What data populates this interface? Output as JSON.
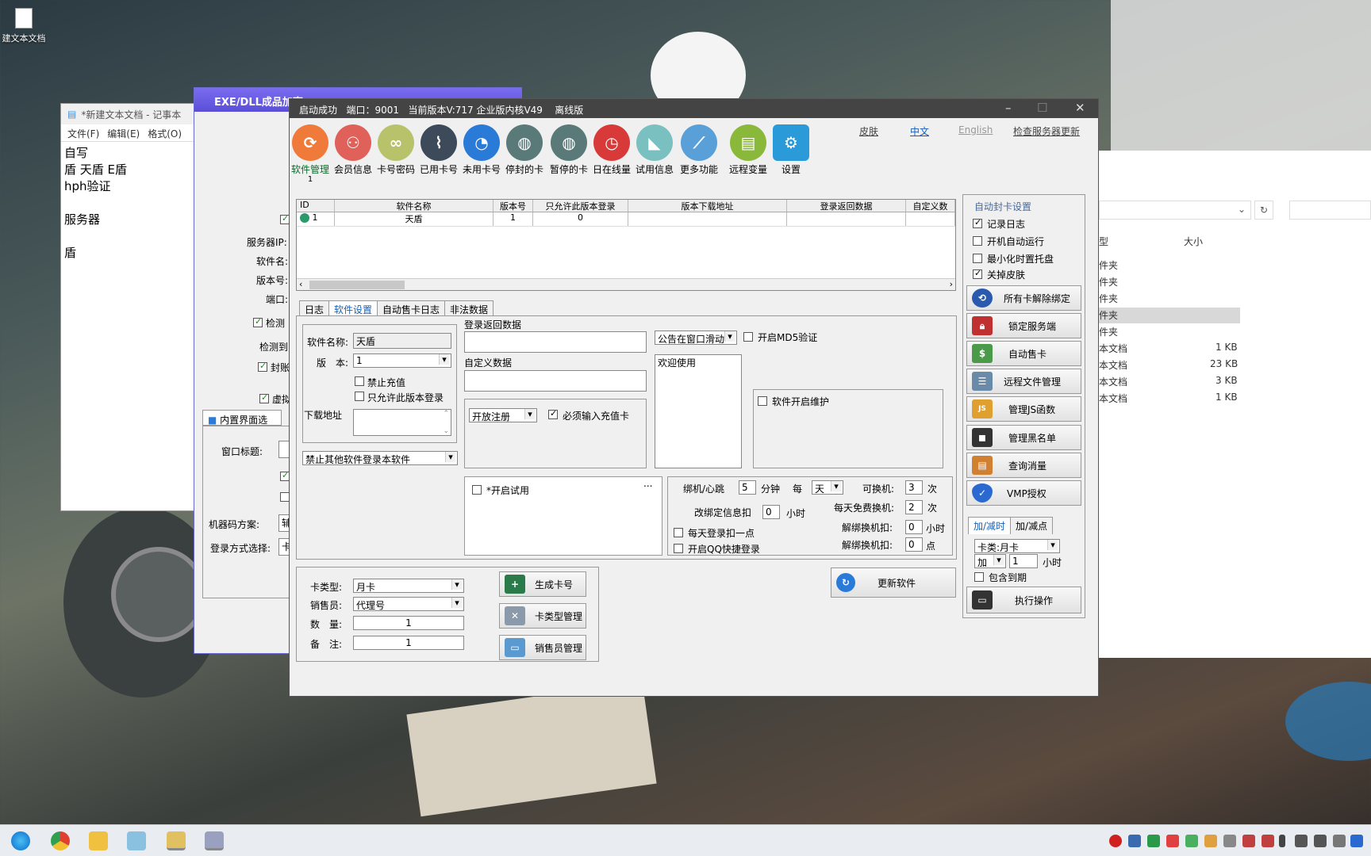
{
  "desktop": {
    "icon_label": "建文本文档"
  },
  "notepad": {
    "title": "*新建文本文档 - 记事本",
    "menu": [
      "文件(F)",
      "编辑(E)",
      "格式(O)"
    ],
    "content": "自写\n盾 天盾 E盾\nhph验证\n\n服务器\n\n盾"
  },
  "exewin": {
    "title": "EXE/DLL成品加壳",
    "labels": {
      "server_ip": "服务器IP:",
      "soft_name": "软件名:",
      "version": "版本号:",
      "port": "端口:",
      "detect": "检测",
      "detect2": "检测到",
      "block": "封账",
      "virtual": "虚拟",
      "tab": "内置界面选择",
      "win_title": "窗口标题:",
      "machine": "机器码方案:",
      "login": "登录方式选择:"
    }
  },
  "explorer": {
    "headers": {
      "type": "型",
      "size": "大小"
    },
    "rows": [
      {
        "t": "件夹",
        "s": ""
      },
      {
        "t": "件夹",
        "s": ""
      },
      {
        "t": "件夹",
        "s": ""
      },
      {
        "t": "件夹",
        "s": ""
      },
      {
        "t": "件夹",
        "s": ""
      },
      {
        "t": "本文档",
        "s": "1 KB"
      },
      {
        "t": "本文档",
        "s": "23 KB"
      },
      {
        "t": "本文档",
        "s": "3 KB"
      },
      {
        "t": "本文档",
        "s": "1 KB"
      }
    ]
  },
  "main": {
    "status": {
      "login": "启动成功",
      "port": "端口：9001",
      "version": "当前版本V:717 企业版内核V49",
      "mode": "离线版"
    },
    "toolbar": [
      {
        "label": "软件管理",
        "icon": "refresh-icon",
        "color": "#f07a3a",
        "active": true
      },
      {
        "label": "会员信息",
        "icon": "members-icon",
        "color": "#e0605a"
      },
      {
        "label": "卡号密码",
        "icon": "link-icon",
        "color": "#b8c26a"
      },
      {
        "label": "已用卡号",
        "icon": "clip-icon",
        "color": "#3c4a5a"
      },
      {
        "label": "未用卡号",
        "icon": "pie-icon",
        "color": "#2a7ad8"
      },
      {
        "label": "停封的卡",
        "icon": "globe-icon",
        "color": "#5a7a7a"
      },
      {
        "label": "暂停的卡",
        "icon": "globe-icon",
        "color": "#5a7a7a"
      },
      {
        "label": "日在线量",
        "icon": "clock-icon",
        "color": "#d83a3a"
      },
      {
        "label": "试用信息",
        "icon": "megaphone-icon",
        "color": "#7ac0c0"
      },
      {
        "label": "更多功能",
        "icon": "chart-icon",
        "color": "#5aa0d8"
      },
      {
        "label": "远程变量",
        "icon": "doc-icon",
        "color": "#8ab83a"
      },
      {
        "label": "设置",
        "icon": "gear-icon",
        "color": "#2a9ad8"
      }
    ],
    "toolbar_sub": "1",
    "links": {
      "skin": "皮肤",
      "zh": "中文",
      "en": "English",
      "update": "检查服务器更新"
    },
    "grid": {
      "headers": [
        "ID",
        "软件名称",
        "版本号",
        "只允许此版本登录",
        "版本下载地址",
        "登录返回数据",
        "自定义数"
      ],
      "row": [
        "1",
        "天盾",
        "1",
        "0",
        "",
        "",
        ""
      ]
    },
    "tabs": [
      "日志",
      "软件设置",
      "自动售卡日志",
      "非法数据"
    ],
    "settings": {
      "soft_name_label": "软件名称:",
      "soft_name": "天盾",
      "version_label": "版　本:",
      "version": "1",
      "no_recharge": "禁止充值",
      "only_version": "只允许此版本登录",
      "download_label": "下载地址",
      "forbid_other": "禁止其他软件登录本软件",
      "login_return": "登录返回数据",
      "custom_data": "自定义数据",
      "notice_mode": "公告在窗口滑动",
      "md5": "开启MD5验证",
      "notice_text": "欢迎使用",
      "open_reg": "开放注册",
      "must_card": "必须输入充值卡",
      "maintain": "软件开启维护",
      "trial": "*开启试用",
      "more": "...",
      "bind": "绑机/心跳",
      "bind_val": "5",
      "minute": "分钟",
      "every": "每",
      "day": "天",
      "can_change": "可换机:",
      "can_change_val": "3",
      "times": "次",
      "change_deduct": "改绑定信息扣",
      "change_deduct_val": "0",
      "hour": "小时",
      "free_change": "每天免费换机:",
      "free_change_val": "2",
      "daily_deduct": "每天登录扣一点",
      "unbind_deduct_h": "解绑换机扣:",
      "unbind_h_val": "0",
      "unbind_hour": "小时",
      "qq": "开启QQ快捷登录",
      "unbind_deduct_p": "解绑换机扣:",
      "unbind_p_val": "0",
      "point": "点"
    },
    "card": {
      "type_label": "卡类型:",
      "type": "月卡",
      "seller_label": "销售员:",
      "seller": "代理号",
      "qty_label": "数　量:",
      "qty": "1",
      "note_label": "备　注:",
      "note": "1",
      "gen": "生成卡号",
      "type_mgr": "卡类型管理",
      "seller_mgr": "销售员管理",
      "update": "更新软件"
    },
    "right": {
      "group": "自动封卡设置",
      "log": "记录日志",
      "autorun": "开机自动运行",
      "tray": "最小化时置托盘",
      "skin_off": "关掉皮肤",
      "buttons": [
        "所有卡解除绑定",
        "锁定服务端",
        "自动售卡",
        "远程文件管理",
        "管理JS函数",
        "管理黑名单",
        "查询消量",
        "VMP授权"
      ],
      "tabs": [
        "加/减时",
        "加/减点"
      ],
      "card_type": "卡类:月卡",
      "op": "加",
      "op_val": "1",
      "op_unit": "小时",
      "include": "包含到期",
      "exec": "执行操作"
    }
  }
}
